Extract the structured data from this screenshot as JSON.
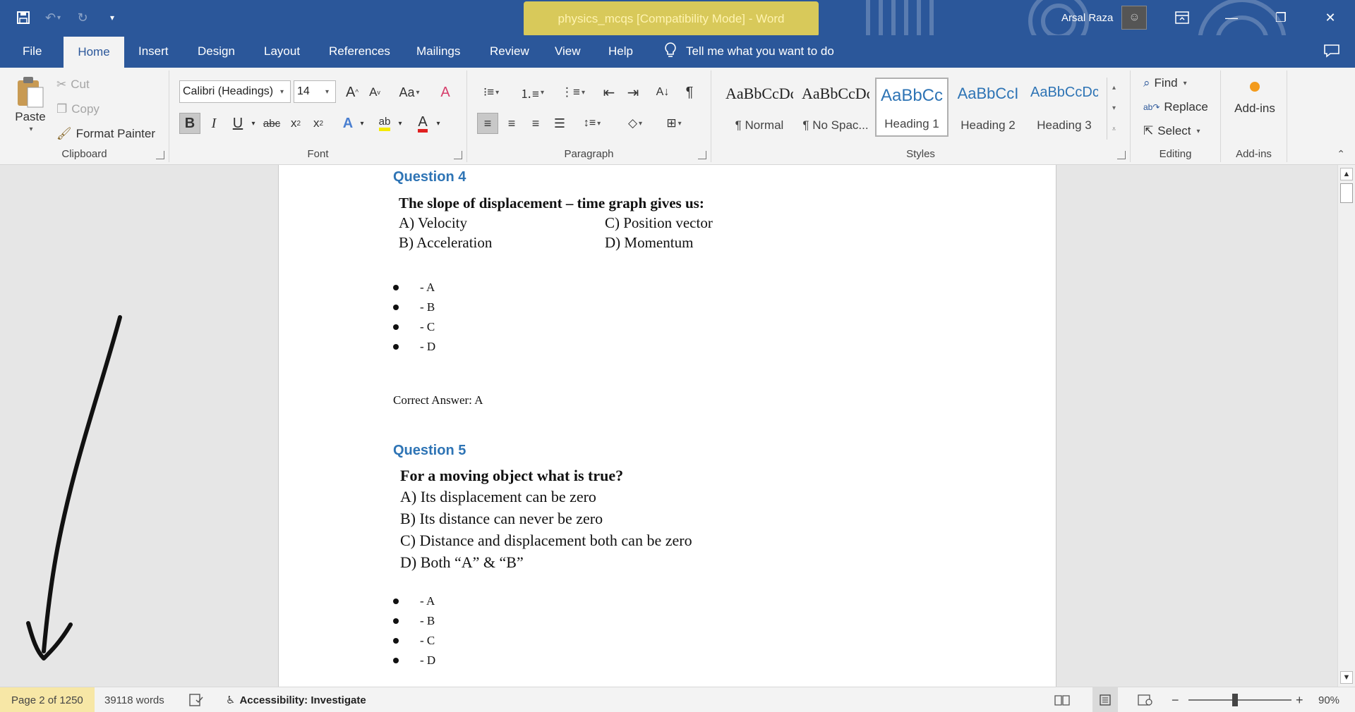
{
  "window": {
    "title": "physics_mcqs [Compatibility Mode]  -  Word",
    "user_name": "Arsal Raza",
    "qat_icons": [
      "save-icon",
      "undo-icon",
      "redo-icon",
      "customize-icon"
    ],
    "controls": [
      "ribbon-display-icon",
      "minimize-icon",
      "restore-icon",
      "close-icon"
    ]
  },
  "tabs": [
    "File",
    "Home",
    "Insert",
    "Design",
    "Layout",
    "References",
    "Mailings",
    "Review",
    "View",
    "Help"
  ],
  "active_tab": "Home",
  "tell_me": "Tell me what you want to do",
  "ribbon": {
    "clipboard": {
      "paste": "Paste",
      "cut": "Cut",
      "copy": "Copy",
      "format_painter": "Format Painter",
      "label": "Clipboard"
    },
    "font": {
      "font_name": "Calibri (Headings)",
      "font_size": "14",
      "change_case": "Aa",
      "label": "Font"
    },
    "paragraph": {
      "label": "Paragraph"
    },
    "styles": {
      "label": "Styles",
      "items": [
        {
          "sample": "AaBbCcDc",
          "name": "¶ Normal"
        },
        {
          "sample": "AaBbCcDc",
          "name": "¶ No Spac..."
        },
        {
          "sample": "AaBbCc",
          "name": "Heading 1"
        },
        {
          "sample": "AaBbCcI",
          "name": "Heading 2"
        },
        {
          "sample": "AaBbCcDc",
          "name": "Heading 3"
        }
      ]
    },
    "editing": {
      "find": "Find",
      "replace": "Replace",
      "select": "Select",
      "label": "Editing"
    },
    "addins": {
      "button": "Add-ins",
      "label": "Add-ins"
    }
  },
  "document": {
    "q4": {
      "heading": "Question 4",
      "stem": "The slope of displacement – time graph gives us:",
      "opt_a": "A) Velocity",
      "opt_c": "C) Position vector",
      "opt_b": "B) Acceleration",
      "opt_d": "D) Momentum",
      "bullets": [
        "- A",
        "- B",
        "- C",
        "- D"
      ],
      "answer": "Correct Answer: A"
    },
    "q5": {
      "heading": "Question 5",
      "stem": "For a moving object what is true?",
      "options": [
        "A) Its displacement can be zero",
        "B) Its distance can never be zero",
        "C) Distance and displacement both can be zero",
        "D) Both “A” & “B”"
      ],
      "bullets": [
        "- A",
        "- B",
        "- C",
        "- D"
      ]
    }
  },
  "status": {
    "page": "Page 2 of 1250",
    "words": "39118 words",
    "accessibility": "Accessibility: Investigate",
    "zoom": "90%"
  },
  "colors": {
    "accent": "#2b579a",
    "heading": "#2e74b5",
    "highlight": "#f7e7a6"
  }
}
